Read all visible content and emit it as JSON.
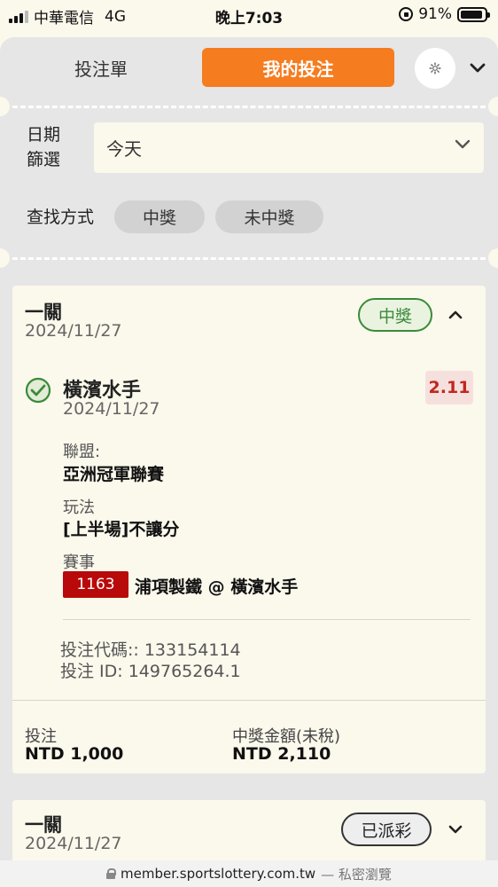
{
  "status_bar": {
    "carrier": "中華電信",
    "network": "4G",
    "time": "晚上7:03",
    "battery": "91%",
    "battery_level": 0.91
  },
  "header": {
    "tab_betslip": "投注單",
    "tab_my_bets": "我的投注",
    "settings_icon": "gear-icon",
    "collapse_icon": "chevron-down-icon"
  },
  "filters": {
    "date_label": "日期\n篩選",
    "date_value": "今天",
    "search_label": "查找方式",
    "chip_won": "中獎",
    "chip_lost": "未中獎"
  },
  "bets": [
    {
      "title": "一關",
      "date": "2024/11/27",
      "status": "中獎",
      "selection": {
        "team": "橫濱水手",
        "date": "2024/11/27",
        "odds": "2.11",
        "league_label": "聯盟:",
        "league": "亞洲冠軍聯賽",
        "market_label": "玩法",
        "market": "[上半場]不讓分",
        "event_label": "賽事",
        "match_no": "1163",
        "event": "浦項製鐵 @ 橫濱水手"
      },
      "bet_code": "投注代碼:: 133154114",
      "bet_id": "投注 ID: 149765264.1",
      "stake_label": "投注",
      "stake": "NTD 1,000",
      "payout_label": "中獎金額(未稅)",
      "payout": "NTD 2,110"
    },
    {
      "title": "一關",
      "date": "2024/11/27",
      "status": "已派彩"
    }
  ],
  "url_bar": {
    "domain": "member.sportslottery.com.tw",
    "mode": "— 私密瀏覽"
  },
  "colors": {
    "accent": "#f57c1f",
    "won": "#3a8a3a",
    "odds": "#c0281e",
    "match_no_bg": "#b80a0a"
  }
}
